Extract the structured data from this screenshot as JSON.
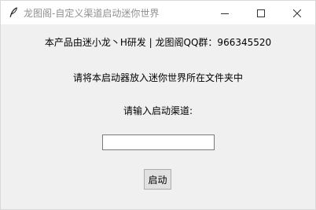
{
  "window": {
    "title": "龙图阁-自定义渠道启动迷你世界",
    "icons": {
      "app": "feather-icon",
      "minimize": "minimize-icon",
      "maximize": "maximize-icon",
      "close": "close-icon"
    }
  },
  "main": {
    "credit_text": "本产品由迷小龙丶H研发 | 龙图阁QQ群：966345520",
    "instruction_text": "请将本启动器放入迷你世界所在文件夹中",
    "channel_prompt": "请输入启动渠道:",
    "channel_input_value": "",
    "start_button_label": "启动"
  }
}
